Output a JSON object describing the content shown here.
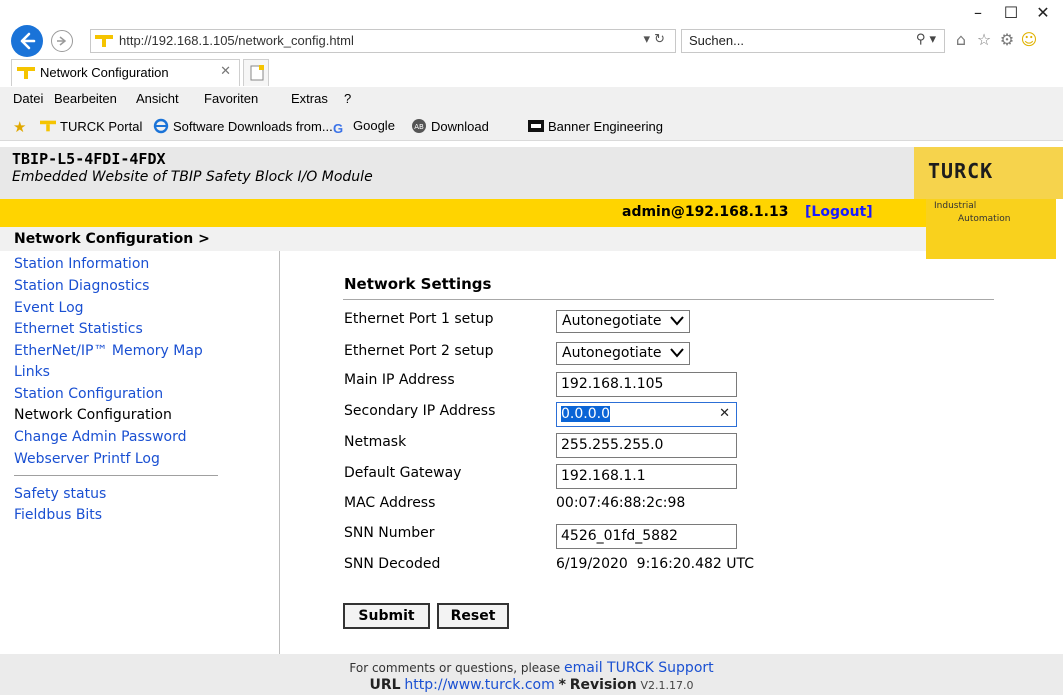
{
  "browser": {
    "url": "http://192.168.1.105/network_config.html",
    "search_placeholder": "Suchen...",
    "tab_title": "Network Configuration",
    "menu": [
      "Datei",
      "Bearbeiten",
      "Ansicht",
      "Favoriten",
      "Extras",
      "?"
    ],
    "favorites": [
      "TURCK Portal",
      "Software Downloads from...",
      "Google",
      "Download",
      "Banner Engineering"
    ]
  },
  "header": {
    "device": "TBIP-L5-4FDI-4FDX",
    "subtitle": "Embedded Website of TBIP Safety Block I/O Module",
    "logo": "TURCK",
    "logo_line1": "Industrial",
    "logo_line2": "Automation",
    "user": "admin@192.168.1.13",
    "logout": "[Logout]",
    "breadcrumb": "Network Configuration >",
    "brand_color": "#ffd400"
  },
  "sidebar": {
    "items": [
      "Station Information",
      "Station Diagnostics",
      "Event Log",
      "Ethernet Statistics",
      "EtherNet/IP™ Memory Map",
      "Links",
      "Station Configuration",
      "Network Configuration",
      "Change Admin Password",
      "Webserver Printf Log"
    ],
    "items2": [
      "Safety status",
      "Fieldbus Bits"
    ],
    "current": "Network Configuration"
  },
  "form": {
    "title": "Network Settings",
    "port1": {
      "label": "Ethernet Port 1 setup",
      "value": "Autonegotiate"
    },
    "port2": {
      "label": "Ethernet Port 2 setup",
      "value": "Autonegotiate"
    },
    "main_ip": {
      "label": "Main IP Address",
      "value": "192.168.1.105"
    },
    "secondary_ip": {
      "label": "Secondary IP Address",
      "value": "0.0.0.0"
    },
    "netmask": {
      "label": "Netmask",
      "value": "255.255.255.0"
    },
    "gateway": {
      "label": "Default Gateway",
      "value": "192.168.1.1"
    },
    "mac": {
      "label": "MAC Address",
      "value": "00:07:46:88:2c:98"
    },
    "snn": {
      "label": "SNN Number",
      "value": "4526_01fd_5882"
    },
    "snn_decoded": {
      "label": "SNN Decoded",
      "value": "6/19/2020  9:16:20.482 UTC"
    },
    "submit": "Submit",
    "reset": "Reset"
  },
  "footer": {
    "text1": "For comments or questions, please",
    "link1": "email TURCK Support",
    "url_label": "URL",
    "url": "http://www.turck.com",
    "sep": "*",
    "rev_label": "Revision",
    "rev": "V2.1.17.0"
  }
}
